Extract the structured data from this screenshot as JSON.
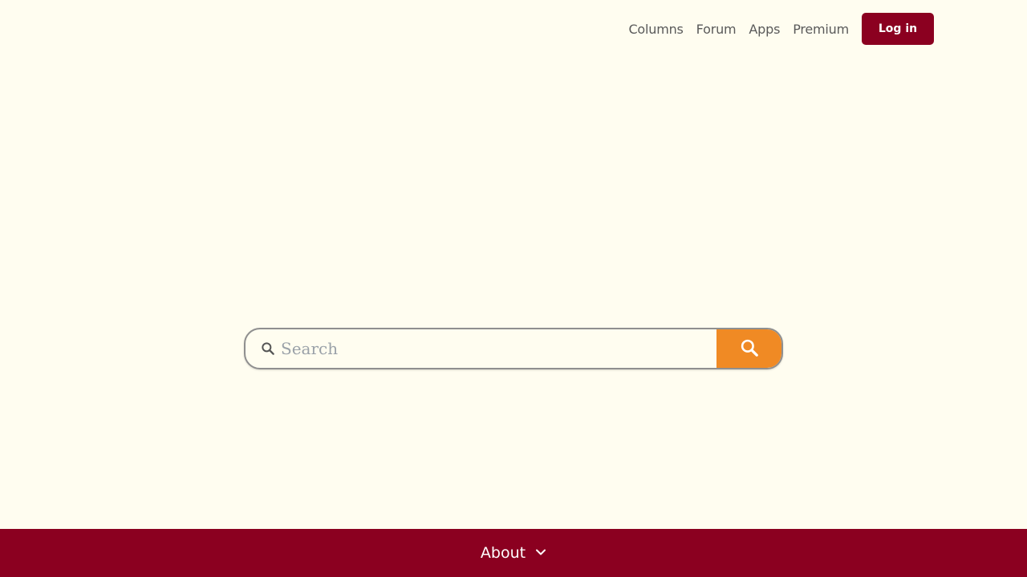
{
  "nav": {
    "links": [
      "Columns",
      "Forum",
      "Apps",
      "Premium"
    ],
    "login_label": "Log in"
  },
  "search": {
    "placeholder": "Search",
    "value": ""
  },
  "footer": {
    "about_label": "About"
  },
  "colors": {
    "background": "#fffdf0",
    "brand": "#8b0020",
    "search_button": "#f08a24"
  },
  "icons": {
    "search_inline": "search-icon",
    "search_button": "search-icon",
    "about_toggle": "chevron-down-icon"
  }
}
